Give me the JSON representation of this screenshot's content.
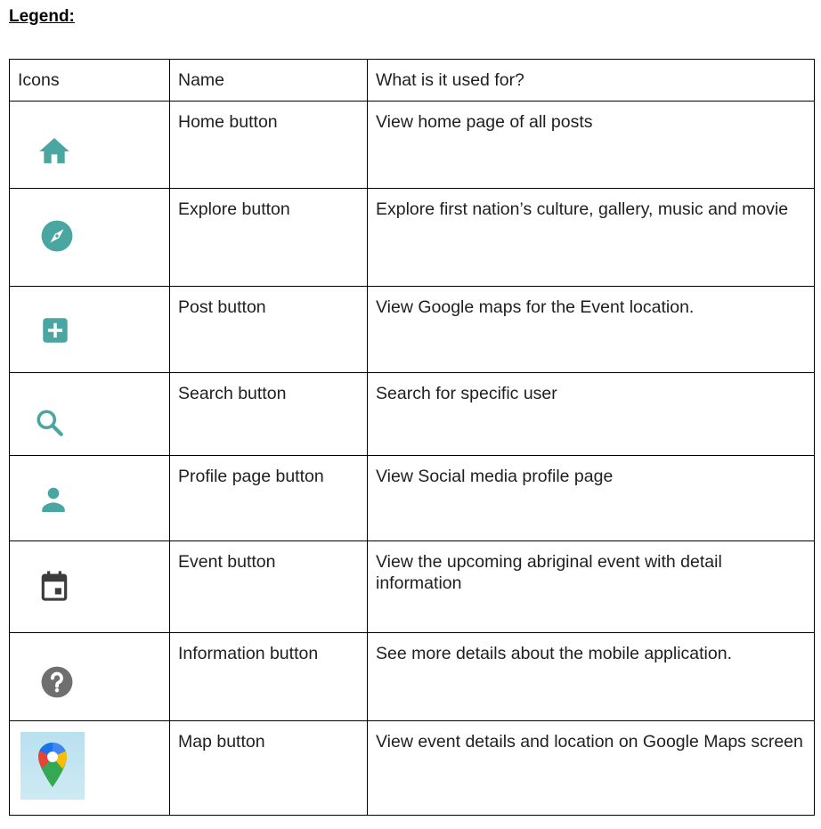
{
  "heading": "Legend:",
  "columns": {
    "icons": "Icons",
    "name": "Name",
    "use": "What is it used for?"
  },
  "rows": [
    {
      "icon": "home-icon",
      "name": "Home button",
      "use": "View home page of all posts"
    },
    {
      "icon": "explore-compass-icon",
      "name": "Explore button",
      "use": "Explore first nation’s culture, gallery, music and movie"
    },
    {
      "icon": "add-post-icon",
      "name": "Post button",
      "use": "View Google maps for the Event location."
    },
    {
      "icon": "search-icon",
      "name": "Search button",
      "use": "Search for specific user"
    },
    {
      "icon": "profile-person-icon",
      "name": "Profile page button",
      "use": "View Social media profile page"
    },
    {
      "icon": "calendar-event-icon",
      "name": "Event button",
      "use": "View the upcoming abriginal event with detail information"
    },
    {
      "icon": "help-question-icon",
      "name": "Information button",
      "use": "See more details about the mobile application."
    },
    {
      "icon": "google-maps-pin-icon",
      "name": "Map button",
      "use": "View event details and location on Google Maps screen"
    }
  ],
  "colors": {
    "teal": "#4aa6a1",
    "dark_gray": "#3c3c3c",
    "mid_gray": "#6f6f6f"
  }
}
